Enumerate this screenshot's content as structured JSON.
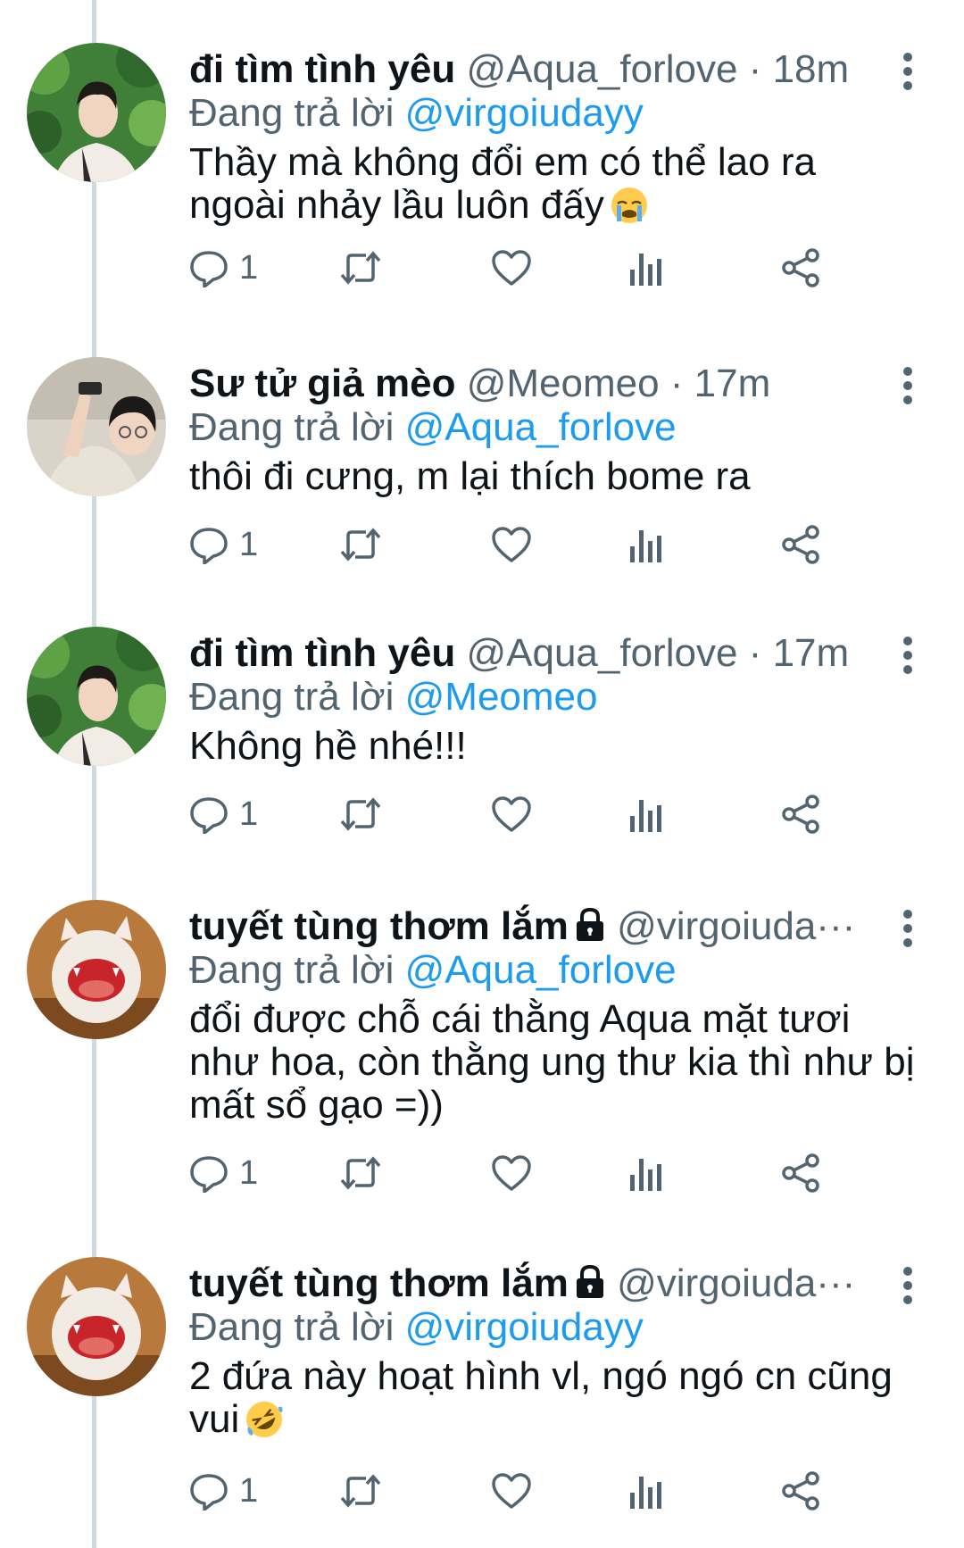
{
  "colors": {
    "text": "#0f1419",
    "secondary": "#536471",
    "link": "#1d9bf0",
    "thread_line": "#cfd9de"
  },
  "tweets": [
    {
      "name": "đi tìm tình yêu",
      "handle": "@Aqua_forlove",
      "dot": "·",
      "time": "18m",
      "replying_prefix": "Đang trả lời",
      "replying_to": "@virgoiudayy",
      "text": "Thầy mà không đổi em có thể lao ra ngoài nhảy lầu luôn đấy",
      "emoji": "loudly-crying-face",
      "reply_count": "1",
      "locked": false,
      "avatar": "boy-looking-up"
    },
    {
      "name": "Sư tử giả mèo",
      "handle": "@Meomeo",
      "dot": "·",
      "time": "17m",
      "replying_prefix": "Đang trả lời",
      "replying_to": "@Aqua_forlove",
      "text": "thôi đi cưng, m lại thích bome ra",
      "reply_count": "1",
      "locked": false,
      "avatar": "boy-taking-photo"
    },
    {
      "name": "đi tìm tình yêu",
      "handle": "@Aqua_forlove",
      "dot": "·",
      "time": "17m",
      "replying_prefix": "Đang trả lời",
      "replying_to": "@Meomeo",
      "text": "Không hề nhé!!!",
      "reply_count": "1",
      "locked": false,
      "avatar": "boy-looking-up"
    },
    {
      "name": "tuyết tùng thơm lắm",
      "handle": "@virgoiuda···",
      "replying_prefix": "Đang trả lời",
      "replying_to": "@Aqua_forlove",
      "text": "đổi được chỗ cái thằng Aqua mặt tươi như hoa, còn thằng ung thư kia thì như bị mất sổ gạo =))",
      "reply_count": "1",
      "locked": true,
      "avatar": "felt-monster"
    },
    {
      "name": "tuyết tùng thơm lắm",
      "handle": "@virgoiuda···",
      "replying_prefix": "Đang trả lời",
      "replying_to": "@virgoiudayy",
      "text": "2 đứa này hoạt hình vl, ngó ngó cn cũng vui",
      "emoji": "rolling-on-floor-laughing",
      "reply_count": "1",
      "locked": true,
      "avatar": "felt-monster"
    }
  ]
}
